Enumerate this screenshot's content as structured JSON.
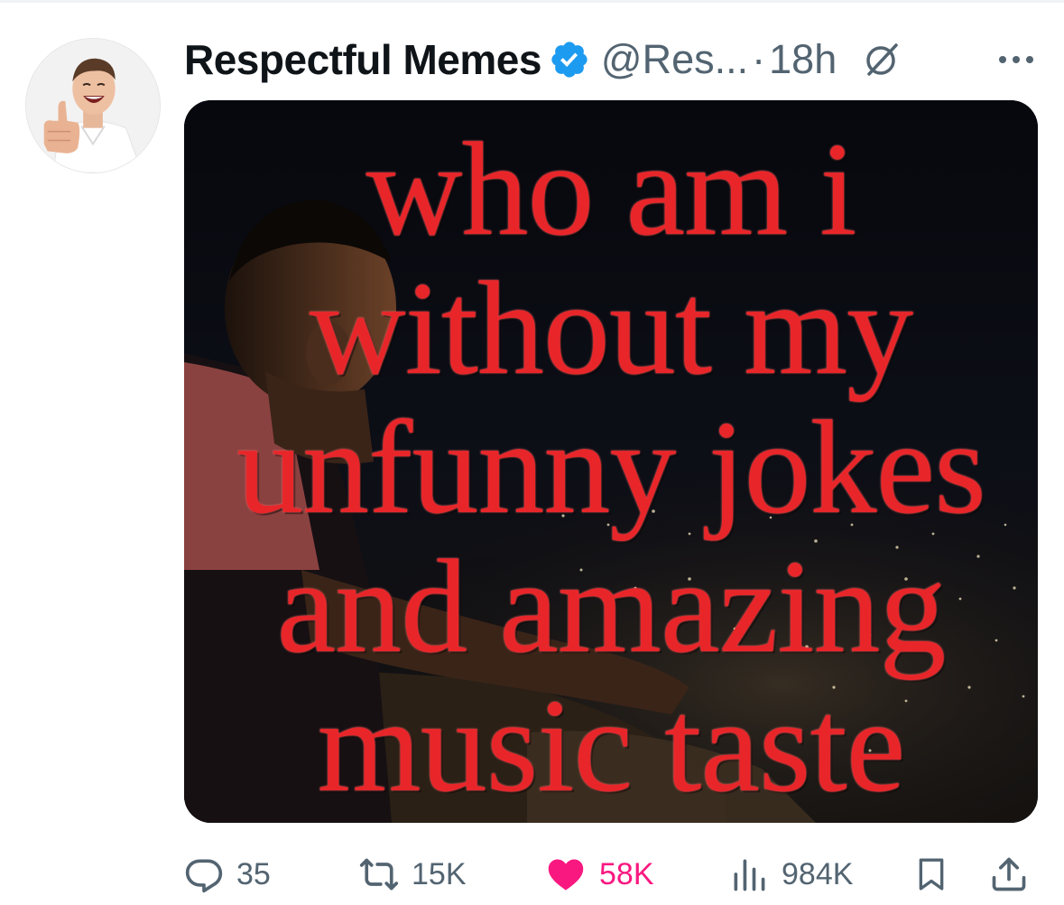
{
  "author": {
    "display_name": "Respectful Memes",
    "handle": "@Res...",
    "separator": "·",
    "time": "18h",
    "verified": true
  },
  "icons": {
    "verified": "verified-badge-icon",
    "grok": "grok-icon",
    "more": "more-icon",
    "reply": "reply-icon",
    "repost": "repost-icon",
    "like": "heart-icon",
    "views": "views-icon",
    "bookmark": "bookmark-icon",
    "share": "share-icon"
  },
  "media": {
    "meme_lines": [
      "who am i",
      "without my",
      "unfunny jokes",
      "and amazing",
      "music taste"
    ]
  },
  "actions": {
    "replies": "35",
    "reposts": "15K",
    "likes": "58K",
    "views": "984K",
    "liked": true
  },
  "colors": {
    "verified_blue": "#1d9bf0",
    "like_pink": "#f91880",
    "secondary_text": "#536471",
    "meme_red": "#e8262a"
  }
}
